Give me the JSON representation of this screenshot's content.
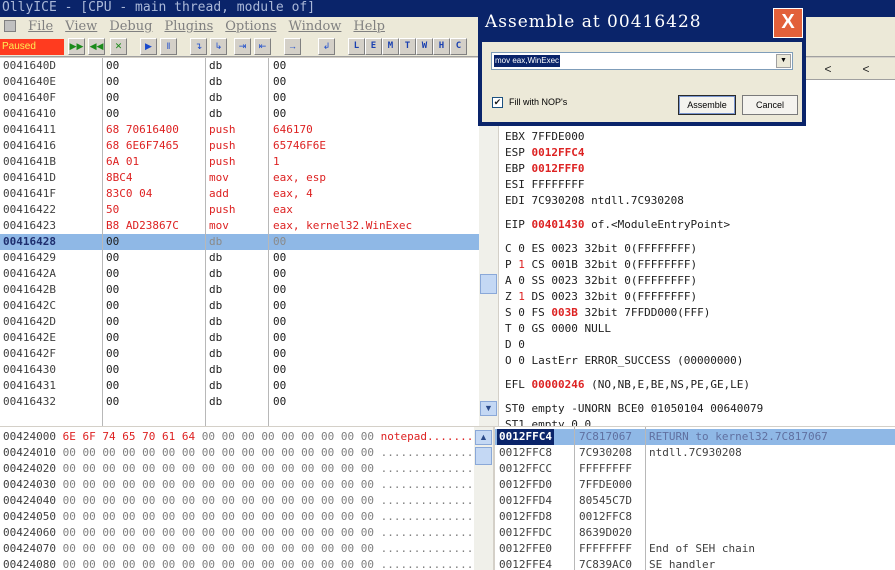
{
  "window": {
    "title": "OllyICE - [CPU - main thread, module of]"
  },
  "menu": [
    "File",
    "View",
    "Debug",
    "Plugins",
    "Options",
    "Window",
    "Help"
  ],
  "toolbar": {
    "status": "Paused",
    "buttons": [
      "▶▶",
      "◀◀",
      "✕",
      "▶",
      "‖",
      "↴",
      "↳",
      "⇥",
      "⇤",
      "→",
      "↲"
    ],
    "letters": [
      "L",
      "E",
      "M",
      "T",
      "W",
      "H",
      "C"
    ]
  },
  "disassembly": [
    {
      "addr": "0041640D",
      "hex": "00",
      "mnem": "db",
      "operand": "00",
      "style": "plain"
    },
    {
      "addr": "0041640E",
      "hex": "00",
      "mnem": "db",
      "operand": "00",
      "style": "plain"
    },
    {
      "addr": "0041640F",
      "hex": "00",
      "mnem": "db",
      "operand": "00",
      "style": "plain"
    },
    {
      "addr": "00416410",
      "hex": "00",
      "mnem": "db",
      "operand": "00",
      "style": "plain"
    },
    {
      "addr": "00416411",
      "hex": "68 70616400",
      "mnem": "push",
      "operand": "646170",
      "style": "red"
    },
    {
      "addr": "00416416",
      "hex": "68 6E6F7465",
      "mnem": "push",
      "operand": "65746F6E",
      "style": "red"
    },
    {
      "addr": "0041641B",
      "hex": "6A 01",
      "mnem": "push",
      "operand": "1",
      "style": "red"
    },
    {
      "addr": "0041641D",
      "hex": "8BC4",
      "mnem": "mov",
      "operand": "eax, esp",
      "style": "red"
    },
    {
      "addr": "0041641F",
      "hex": "83C0 04",
      "mnem": "add",
      "operand": "eax, 4",
      "style": "red"
    },
    {
      "addr": "00416422",
      "hex": "50",
      "mnem": "push",
      "operand": "eax",
      "style": "red"
    },
    {
      "addr": "00416423",
      "hex": "B8 AD23867C",
      "mnem": "mov",
      "operand": "eax, kernel32.WinExec",
      "style": "red"
    },
    {
      "addr": "00416428",
      "hex": "00",
      "mnem": "db",
      "operand": "00",
      "style": "selected"
    },
    {
      "addr": "00416429",
      "hex": "00",
      "mnem": "db",
      "operand": "00",
      "style": "plain"
    },
    {
      "addr": "0041642A",
      "hex": "00",
      "mnem": "db",
      "operand": "00",
      "style": "plain"
    },
    {
      "addr": "0041642B",
      "hex": "00",
      "mnem": "db",
      "operand": "00",
      "style": "plain"
    },
    {
      "addr": "0041642C",
      "hex": "00",
      "mnem": "db",
      "operand": "00",
      "style": "plain"
    },
    {
      "addr": "0041642D",
      "hex": "00",
      "mnem": "db",
      "operand": "00",
      "style": "plain"
    },
    {
      "addr": "0041642E",
      "hex": "00",
      "mnem": "db",
      "operand": "00",
      "style": "plain"
    },
    {
      "addr": "0041642F",
      "hex": "00",
      "mnem": "db",
      "operand": "00",
      "style": "plain"
    },
    {
      "addr": "00416430",
      "hex": "00",
      "mnem": "db",
      "operand": "00",
      "style": "plain"
    },
    {
      "addr": "00416431",
      "hex": "00",
      "mnem": "db",
      "operand": "00",
      "style": "plain"
    },
    {
      "addr": "00416432",
      "hex": "00",
      "mnem": "db",
      "operand": "00",
      "style": "plain"
    }
  ],
  "registers": {
    "nav": [
      "<",
      "<"
    ],
    "lines": [
      {
        "name": "EBX",
        "value": "7FFDE000",
        "changed": false,
        "comment": ""
      },
      {
        "name": "ESP",
        "value": "0012FFC4",
        "changed": true,
        "comment": ""
      },
      {
        "name": "EBP",
        "value": "0012FFF0",
        "changed": true,
        "comment": ""
      },
      {
        "name": "ESI",
        "value": "FFFFFFFF",
        "changed": false,
        "comment": ""
      },
      {
        "name": "EDI",
        "value": "7C930208",
        "changed": false,
        "comment": "ntdll.7C930208"
      },
      {
        "name": "EIP",
        "value": "00401430",
        "changed": true,
        "comment": "of.<ModuleEntryPoint>"
      }
    ],
    "flags": [
      {
        "flag": "C",
        "bit": "0",
        "seg": "ES",
        "sel": "0023",
        "info": "32bit 0(FFFFFFFF)",
        "bit_red": false,
        "sel_red": false
      },
      {
        "flag": "P",
        "bit": "1",
        "seg": "CS",
        "sel": "001B",
        "info": "32bit 0(FFFFFFFF)",
        "bit_red": true,
        "sel_red": false
      },
      {
        "flag": "A",
        "bit": "0",
        "seg": "SS",
        "sel": "0023",
        "info": "32bit 0(FFFFFFFF)",
        "bit_red": false,
        "sel_red": false
      },
      {
        "flag": "Z",
        "bit": "1",
        "seg": "DS",
        "sel": "0023",
        "info": "32bit 0(FFFFFFFF)",
        "bit_red": true,
        "sel_red": false
      },
      {
        "flag": "S",
        "bit": "0",
        "seg": "FS",
        "sel": "003B",
        "info": "32bit 7FFDD000(FFF)",
        "bit_red": false,
        "sel_red": true
      },
      {
        "flag": "T",
        "bit": "0",
        "seg": "GS",
        "sel": "0000",
        "info": "NULL",
        "bit_red": false,
        "sel_red": false
      },
      {
        "flag": "D",
        "bit": "0",
        "seg": "",
        "sel": "",
        "info": "",
        "bit_red": false,
        "sel_red": false
      }
    ],
    "lasterr": "O  0  LastErr ERROR_SUCCESS (00000000)",
    "efl_label": "EFL",
    "efl_value": "00000246",
    "efl_flags": "(NO,NB,E,BE,NS,PE,GE,LE)",
    "st0": "ST0 empty -UNORN BCE0 01050104 00640079",
    "st1": "ST1 empty 0.0"
  },
  "dump": [
    {
      "addr": "00424000",
      "bytes": [
        "6E",
        "6F",
        "74",
        "65",
        "70",
        "61",
        "64",
        "00",
        "00",
        "00",
        "00",
        "00",
        "00",
        "00",
        "00",
        "00"
      ],
      "ascii": "notepad.........",
      "hot": true
    },
    {
      "addr": "00424010",
      "bytes": [
        "00",
        "00",
        "00",
        "00",
        "00",
        "00",
        "00",
        "00",
        "00",
        "00",
        "00",
        "00",
        "00",
        "00",
        "00",
        "00"
      ],
      "ascii": "................",
      "hot": false
    },
    {
      "addr": "00424020",
      "bytes": [
        "00",
        "00",
        "00",
        "00",
        "00",
        "00",
        "00",
        "00",
        "00",
        "00",
        "00",
        "00",
        "00",
        "00",
        "00",
        "00"
      ],
      "ascii": "................",
      "hot": false
    },
    {
      "addr": "00424030",
      "bytes": [
        "00",
        "00",
        "00",
        "00",
        "00",
        "00",
        "00",
        "00",
        "00",
        "00",
        "00",
        "00",
        "00",
        "00",
        "00",
        "00"
      ],
      "ascii": "................",
      "hot": false
    },
    {
      "addr": "00424040",
      "bytes": [
        "00",
        "00",
        "00",
        "00",
        "00",
        "00",
        "00",
        "00",
        "00",
        "00",
        "00",
        "00",
        "00",
        "00",
        "00",
        "00"
      ],
      "ascii": "................",
      "hot": false
    },
    {
      "addr": "00424050",
      "bytes": [
        "00",
        "00",
        "00",
        "00",
        "00",
        "00",
        "00",
        "00",
        "00",
        "00",
        "00",
        "00",
        "00",
        "00",
        "00",
        "00"
      ],
      "ascii": "................",
      "hot": false
    },
    {
      "addr": "00424060",
      "bytes": [
        "00",
        "00",
        "00",
        "00",
        "00",
        "00",
        "00",
        "00",
        "00",
        "00",
        "00",
        "00",
        "00",
        "00",
        "00",
        "00"
      ],
      "ascii": "................",
      "hot": false
    },
    {
      "addr": "00424070",
      "bytes": [
        "00",
        "00",
        "00",
        "00",
        "00",
        "00",
        "00",
        "00",
        "00",
        "00",
        "00",
        "00",
        "00",
        "00",
        "00",
        "00"
      ],
      "ascii": "................",
      "hot": false
    },
    {
      "addr": "00424080",
      "bytes": [
        "00",
        "00",
        "00",
        "00",
        "00",
        "00",
        "00",
        "00",
        "00",
        "00",
        "00",
        "00",
        "00",
        "00",
        "00",
        "00"
      ],
      "ascii": "................",
      "hot": false
    }
  ],
  "stack": [
    {
      "addr": "0012FFC4",
      "value": "7C817067",
      "comment": "RETURN to kernel32.7C817067",
      "selected": true
    },
    {
      "addr": "0012FFC8",
      "value": "7C930208",
      "comment": "ntdll.7C930208",
      "selected": false
    },
    {
      "addr": "0012FFCC",
      "value": "FFFFFFFF",
      "comment": "",
      "selected": false
    },
    {
      "addr": "0012FFD0",
      "value": "7FFDE000",
      "comment": "",
      "selected": false
    },
    {
      "addr": "0012FFD4",
      "value": "80545C7D",
      "comment": "",
      "selected": false
    },
    {
      "addr": "0012FFD8",
      "value": "0012FFC8",
      "comment": "",
      "selected": false
    },
    {
      "addr": "0012FFDC",
      "value": "8639D020",
      "comment": "",
      "selected": false
    },
    {
      "addr": "0012FFE0",
      "value": "FFFFFFFF",
      "comment": "End of SEH chain",
      "selected": false
    },
    {
      "addr": "0012FFE4",
      "value": "7C839AC0",
      "comment": "SE handler",
      "selected": false
    }
  ],
  "dialog": {
    "title": "Assemble at 00416428",
    "close": "X",
    "input_value": "mov eax,WinExec",
    "dropdown": "▼",
    "fill_nops_label": "Fill with NOP's",
    "fill_nops_checked": true,
    "check_mark": "✔",
    "assemble_label": "Assemble",
    "cancel_label": "Cancel"
  },
  "colors": {
    "title_bar": "#0a246a",
    "changed_red": "#dd2222",
    "selection": "#8fb8e6",
    "close_button": "#e2603a"
  }
}
